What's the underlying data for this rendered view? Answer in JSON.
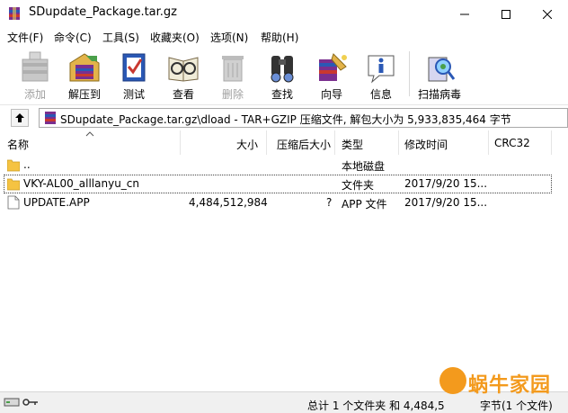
{
  "window": {
    "title": "SDupdate_Package.tar.gz",
    "minimize_icon": "minimize-icon",
    "maximize_icon": "maximize-icon",
    "close_icon": "close-icon"
  },
  "menu": [
    {
      "label": "文件(F)"
    },
    {
      "label": "命令(C)"
    },
    {
      "label": "工具(S)"
    },
    {
      "label": "收藏夹(O)"
    },
    {
      "label": "选项(N)"
    },
    {
      "label": "帮助(H)"
    }
  ],
  "toolbar": [
    {
      "label": "添加",
      "icon": "add-archive-icon",
      "disabled": true
    },
    {
      "label": "解压到",
      "icon": "extract-to-icon",
      "disabled": false
    },
    {
      "label": "测试",
      "icon": "test-icon",
      "disabled": false
    },
    {
      "label": "查看",
      "icon": "view-icon",
      "disabled": false
    },
    {
      "label": "删除",
      "icon": "delete-icon",
      "disabled": true
    },
    {
      "label": "查找",
      "icon": "find-icon",
      "disabled": false
    },
    {
      "label": "向导",
      "icon": "wizard-icon",
      "disabled": false
    },
    {
      "label": "信息",
      "icon": "info-icon",
      "disabled": false
    },
    {
      "label": "扫描病毒",
      "icon": "virus-scan-icon",
      "disabled": false
    }
  ],
  "address": {
    "path": "SDupdate_Package.tar.gz\\dload - TAR+GZIP 压缩文件, 解包大小为 5,933,835,464 字节"
  },
  "columns": {
    "name": "名称",
    "size": "大小",
    "packed": "压缩后大小",
    "type": "类型",
    "modified": "修改时间",
    "crc": "CRC32"
  },
  "files": [
    {
      "name": "..",
      "size": "",
      "packed": "",
      "type": "本地磁盘",
      "modified": "",
      "crc": "",
      "icon": "folder-icon"
    },
    {
      "name": "VKY-AL00_alllanyu_cn",
      "size": "",
      "packed": "",
      "type": "文件夹",
      "modified": "2017/9/20 15...",
      "crc": "",
      "icon": "folder-icon"
    },
    {
      "name": "UPDATE.APP",
      "size": "4,484,512,984",
      "packed": "?",
      "type": "APP 文件",
      "modified": "2017/9/20 15...",
      "crc": "",
      "icon": "file-icon"
    }
  ],
  "status": {
    "text": "总计 1 个文件夹 和 4,484,5",
    "text_tail": "字节(1 个文件)"
  },
  "watermark": {
    "text": "蜗牛家园",
    "small": "S"
  },
  "colors": {
    "accent": "#f39a1d",
    "folder": "#f5c342"
  }
}
